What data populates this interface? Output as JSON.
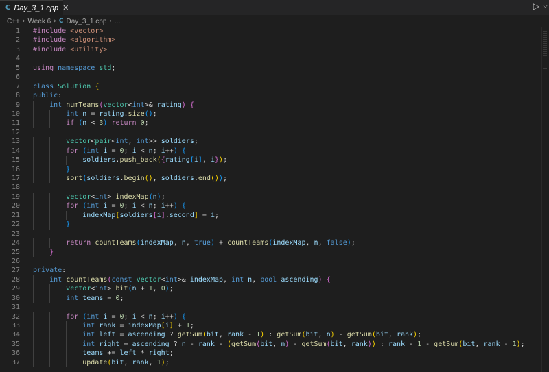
{
  "tab": {
    "icon": "C",
    "label": "Day_3_1.cpp",
    "close": "✕"
  },
  "toolbar": {
    "run": "▷",
    "chevron": "⌵"
  },
  "breadcrumb": {
    "items": [
      "C++",
      "Week 6",
      "Day_3_1.cpp",
      "..."
    ]
  },
  "lines": [
    [
      [
        "c",
        "#include "
      ],
      [
        "s",
        "<vector>"
      ]
    ],
    [
      [
        "c",
        "#include "
      ],
      [
        "s",
        "<algorithm>"
      ]
    ],
    [
      [
        "c",
        "#include "
      ],
      [
        "s",
        "<utility>"
      ]
    ],
    [],
    [
      [
        "c",
        "using "
      ],
      [
        "k",
        "namespace "
      ],
      [
        "t",
        "std"
      ],
      [
        "p",
        ";"
      ]
    ],
    [],
    [
      [
        "k",
        "class "
      ],
      [
        "t",
        "Solution "
      ],
      [
        "b1",
        "{"
      ]
    ],
    [
      [
        "k",
        "public"
      ],
      [
        "p",
        ":"
      ]
    ],
    [
      [
        "p",
        "    "
      ],
      [
        "k",
        "int "
      ],
      [
        "f",
        "numTeams"
      ],
      [
        "b2",
        "("
      ],
      [
        "t",
        "vector"
      ],
      [
        "p",
        "<"
      ],
      [
        "k",
        "int"
      ],
      [
        "p",
        ">& "
      ],
      [
        "v",
        "rating"
      ],
      [
        "b2",
        ")"
      ],
      [
        "p",
        " "
      ],
      [
        "b2",
        "{"
      ]
    ],
    [
      [
        "p",
        "        "
      ],
      [
        "k",
        "int "
      ],
      [
        "v",
        "n"
      ],
      [
        "p",
        " = "
      ],
      [
        "v",
        "rating"
      ],
      [
        "p",
        "."
      ],
      [
        "f",
        "size"
      ],
      [
        "b3",
        "()"
      ],
      [
        "p",
        ";"
      ]
    ],
    [
      [
        "p",
        "        "
      ],
      [
        "c",
        "if "
      ],
      [
        "b3",
        "("
      ],
      [
        "v",
        "n"
      ],
      [
        "p",
        " < "
      ],
      [
        "n",
        "3"
      ],
      [
        "b3",
        ")"
      ],
      [
        "p",
        " "
      ],
      [
        "c",
        "return "
      ],
      [
        "n",
        "0"
      ],
      [
        "p",
        ";"
      ]
    ],
    [],
    [
      [
        "p",
        "        "
      ],
      [
        "t",
        "vector"
      ],
      [
        "p",
        "<"
      ],
      [
        "t",
        "pair"
      ],
      [
        "p",
        "<"
      ],
      [
        "k",
        "int"
      ],
      [
        "p",
        ", "
      ],
      [
        "k",
        "int"
      ],
      [
        "p",
        ">> "
      ],
      [
        "v",
        "soldiers"
      ],
      [
        "p",
        ";"
      ]
    ],
    [
      [
        "p",
        "        "
      ],
      [
        "c",
        "for "
      ],
      [
        "b3",
        "("
      ],
      [
        "k",
        "int "
      ],
      [
        "v",
        "i"
      ],
      [
        "p",
        " = "
      ],
      [
        "n",
        "0"
      ],
      [
        "p",
        "; "
      ],
      [
        "v",
        "i"
      ],
      [
        "p",
        " < "
      ],
      [
        "v",
        "n"
      ],
      [
        "p",
        "; "
      ],
      [
        "v",
        "i"
      ],
      [
        "p",
        "++"
      ],
      [
        "b3",
        ")"
      ],
      [
        "p",
        " "
      ],
      [
        "b3",
        "{"
      ]
    ],
    [
      [
        "p",
        "            "
      ],
      [
        "v",
        "soldiers"
      ],
      [
        "p",
        "."
      ],
      [
        "f",
        "push_back"
      ],
      [
        "b1",
        "("
      ],
      [
        "b2",
        "{"
      ],
      [
        "v",
        "rating"
      ],
      [
        "b3",
        "["
      ],
      [
        "v",
        "i"
      ],
      [
        "b3",
        "]"
      ],
      [
        "p",
        ", "
      ],
      [
        "v",
        "i"
      ],
      [
        "b2",
        "}"
      ],
      [
        "b1",
        ")"
      ],
      [
        "p",
        ";"
      ]
    ],
    [
      [
        "p",
        "        "
      ],
      [
        "b3",
        "}"
      ]
    ],
    [
      [
        "p",
        "        "
      ],
      [
        "f",
        "sort"
      ],
      [
        "b3",
        "("
      ],
      [
        "v",
        "soldiers"
      ],
      [
        "p",
        "."
      ],
      [
        "f",
        "begin"
      ],
      [
        "b1",
        "()"
      ],
      [
        "p",
        ", "
      ],
      [
        "v",
        "soldiers"
      ],
      [
        "p",
        "."
      ],
      [
        "f",
        "end"
      ],
      [
        "b1",
        "()"
      ],
      [
        "b3",
        ")"
      ],
      [
        "p",
        ";"
      ]
    ],
    [],
    [
      [
        "p",
        "        "
      ],
      [
        "t",
        "vector"
      ],
      [
        "p",
        "<"
      ],
      [
        "k",
        "int"
      ],
      [
        "p",
        "> "
      ],
      [
        "f",
        "indexMap"
      ],
      [
        "b3",
        "("
      ],
      [
        "v",
        "n"
      ],
      [
        "b3",
        ")"
      ],
      [
        "p",
        ";"
      ]
    ],
    [
      [
        "p",
        "        "
      ],
      [
        "c",
        "for "
      ],
      [
        "b3",
        "("
      ],
      [
        "k",
        "int "
      ],
      [
        "v",
        "i"
      ],
      [
        "p",
        " = "
      ],
      [
        "n",
        "0"
      ],
      [
        "p",
        "; "
      ],
      [
        "v",
        "i"
      ],
      [
        "p",
        " < "
      ],
      [
        "v",
        "n"
      ],
      [
        "p",
        "; "
      ],
      [
        "v",
        "i"
      ],
      [
        "p",
        "++"
      ],
      [
        "b3",
        ")"
      ],
      [
        "p",
        " "
      ],
      [
        "b3",
        "{"
      ]
    ],
    [
      [
        "p",
        "            "
      ],
      [
        "v",
        "indexMap"
      ],
      [
        "b1",
        "["
      ],
      [
        "v",
        "soldiers"
      ],
      [
        "b2",
        "["
      ],
      [
        "v",
        "i"
      ],
      [
        "b2",
        "]"
      ],
      [
        "p",
        "."
      ],
      [
        "v",
        "second"
      ],
      [
        "b1",
        "]"
      ],
      [
        "p",
        " = "
      ],
      [
        "v",
        "i"
      ],
      [
        "p",
        ";"
      ]
    ],
    [
      [
        "p",
        "        "
      ],
      [
        "b3",
        "}"
      ]
    ],
    [],
    [
      [
        "p",
        "        "
      ],
      [
        "c",
        "return "
      ],
      [
        "f",
        "countTeams"
      ],
      [
        "b3",
        "("
      ],
      [
        "v",
        "indexMap"
      ],
      [
        "p",
        ", "
      ],
      [
        "v",
        "n"
      ],
      [
        "p",
        ", "
      ],
      [
        "k",
        "true"
      ],
      [
        "b3",
        ")"
      ],
      [
        "p",
        " + "
      ],
      [
        "f",
        "countTeams"
      ],
      [
        "b3",
        "("
      ],
      [
        "v",
        "indexMap"
      ],
      [
        "p",
        ", "
      ],
      [
        "v",
        "n"
      ],
      [
        "p",
        ", "
      ],
      [
        "k",
        "false"
      ],
      [
        "b3",
        ")"
      ],
      [
        "p",
        ";"
      ]
    ],
    [
      [
        "p",
        "    "
      ],
      [
        "b2",
        "}"
      ]
    ],
    [],
    [
      [
        "k",
        "private"
      ],
      [
        "p",
        ":"
      ]
    ],
    [
      [
        "p",
        "    "
      ],
      [
        "k",
        "int "
      ],
      [
        "f",
        "countTeams"
      ],
      [
        "b2",
        "("
      ],
      [
        "k",
        "const "
      ],
      [
        "t",
        "vector"
      ],
      [
        "p",
        "<"
      ],
      [
        "k",
        "int"
      ],
      [
        "p",
        ">& "
      ],
      [
        "v",
        "indexMap"
      ],
      [
        "p",
        ", "
      ],
      [
        "k",
        "int "
      ],
      [
        "v",
        "n"
      ],
      [
        "p",
        ", "
      ],
      [
        "k",
        "bool "
      ],
      [
        "v",
        "ascending"
      ],
      [
        "b2",
        ")"
      ],
      [
        "p",
        " "
      ],
      [
        "b2",
        "{"
      ]
    ],
    [
      [
        "p",
        "        "
      ],
      [
        "t",
        "vector"
      ],
      [
        "p",
        "<"
      ],
      [
        "k",
        "int"
      ],
      [
        "p",
        "> "
      ],
      [
        "f",
        "bit"
      ],
      [
        "b3",
        "("
      ],
      [
        "v",
        "n"
      ],
      [
        "p",
        " + "
      ],
      [
        "n",
        "1"
      ],
      [
        "p",
        ", "
      ],
      [
        "n",
        "0"
      ],
      [
        "b3",
        ")"
      ],
      [
        "p",
        ";"
      ]
    ],
    [
      [
        "p",
        "        "
      ],
      [
        "k",
        "int "
      ],
      [
        "v",
        "teams"
      ],
      [
        "p",
        " = "
      ],
      [
        "n",
        "0"
      ],
      [
        "p",
        ";"
      ]
    ],
    [],
    [
      [
        "p",
        "        "
      ],
      [
        "c",
        "for "
      ],
      [
        "b3",
        "("
      ],
      [
        "k",
        "int "
      ],
      [
        "v",
        "i"
      ],
      [
        "p",
        " = "
      ],
      [
        "n",
        "0"
      ],
      [
        "p",
        "; "
      ],
      [
        "v",
        "i"
      ],
      [
        "p",
        " < "
      ],
      [
        "v",
        "n"
      ],
      [
        "p",
        "; "
      ],
      [
        "v",
        "i"
      ],
      [
        "p",
        "++"
      ],
      [
        "b3",
        ")"
      ],
      [
        "p",
        " "
      ],
      [
        "b3",
        "{"
      ]
    ],
    [
      [
        "p",
        "            "
      ],
      [
        "k",
        "int "
      ],
      [
        "v",
        "rank"
      ],
      [
        "p",
        " = "
      ],
      [
        "v",
        "indexMap"
      ],
      [
        "b1",
        "["
      ],
      [
        "v",
        "i"
      ],
      [
        "b1",
        "]"
      ],
      [
        "p",
        " + "
      ],
      [
        "n",
        "1"
      ],
      [
        "p",
        ";"
      ]
    ],
    [
      [
        "p",
        "            "
      ],
      [
        "k",
        "int "
      ],
      [
        "v",
        "left"
      ],
      [
        "p",
        " = "
      ],
      [
        "v",
        "ascending"
      ],
      [
        "p",
        " ? "
      ],
      [
        "f",
        "getSum"
      ],
      [
        "b1",
        "("
      ],
      [
        "v",
        "bit"
      ],
      [
        "p",
        ", "
      ],
      [
        "v",
        "rank"
      ],
      [
        "p",
        " - "
      ],
      [
        "n",
        "1"
      ],
      [
        "b1",
        ")"
      ],
      [
        "p",
        " : "
      ],
      [
        "f",
        "getSum"
      ],
      [
        "b1",
        "("
      ],
      [
        "v",
        "bit"
      ],
      [
        "p",
        ", "
      ],
      [
        "v",
        "n"
      ],
      [
        "b1",
        ")"
      ],
      [
        "p",
        " - "
      ],
      [
        "f",
        "getSum"
      ],
      [
        "b1",
        "("
      ],
      [
        "v",
        "bit"
      ],
      [
        "p",
        ", "
      ],
      [
        "v",
        "rank"
      ],
      [
        "b1",
        ")"
      ],
      [
        "p",
        ";"
      ]
    ],
    [
      [
        "p",
        "            "
      ],
      [
        "k",
        "int "
      ],
      [
        "v",
        "right"
      ],
      [
        "p",
        " = "
      ],
      [
        "v",
        "ascending"
      ],
      [
        "p",
        " ? "
      ],
      [
        "v",
        "n"
      ],
      [
        "p",
        " - "
      ],
      [
        "v",
        "rank"
      ],
      [
        "p",
        " - "
      ],
      [
        "b1",
        "("
      ],
      [
        "f",
        "getSum"
      ],
      [
        "b2",
        "("
      ],
      [
        "v",
        "bit"
      ],
      [
        "p",
        ", "
      ],
      [
        "v",
        "n"
      ],
      [
        "b2",
        ")"
      ],
      [
        "p",
        " - "
      ],
      [
        "f",
        "getSum"
      ],
      [
        "b2",
        "("
      ],
      [
        "v",
        "bit"
      ],
      [
        "p",
        ", "
      ],
      [
        "v",
        "rank"
      ],
      [
        "b2",
        ")"
      ],
      [
        "b1",
        ")"
      ],
      [
        "p",
        " : "
      ],
      [
        "v",
        "rank"
      ],
      [
        "p",
        " - "
      ],
      [
        "n",
        "1"
      ],
      [
        "p",
        " - "
      ],
      [
        "f",
        "getSum"
      ],
      [
        "b1",
        "("
      ],
      [
        "v",
        "bit"
      ],
      [
        "p",
        ", "
      ],
      [
        "v",
        "rank"
      ],
      [
        "p",
        " - "
      ],
      [
        "n",
        "1"
      ],
      [
        "b1",
        ")"
      ],
      [
        "p",
        ";"
      ]
    ],
    [
      [
        "p",
        "            "
      ],
      [
        "v",
        "teams"
      ],
      [
        "p",
        " += "
      ],
      [
        "v",
        "left"
      ],
      [
        "p",
        " * "
      ],
      [
        "v",
        "right"
      ],
      [
        "p",
        ";"
      ]
    ],
    [
      [
        "p",
        "            "
      ],
      [
        "f",
        "update"
      ],
      [
        "b1",
        "("
      ],
      [
        "v",
        "bit"
      ],
      [
        "p",
        ", "
      ],
      [
        "v",
        "rank"
      ],
      [
        "p",
        ", "
      ],
      [
        "n",
        "1"
      ],
      [
        "b1",
        ")"
      ],
      [
        "p",
        ";"
      ]
    ]
  ]
}
